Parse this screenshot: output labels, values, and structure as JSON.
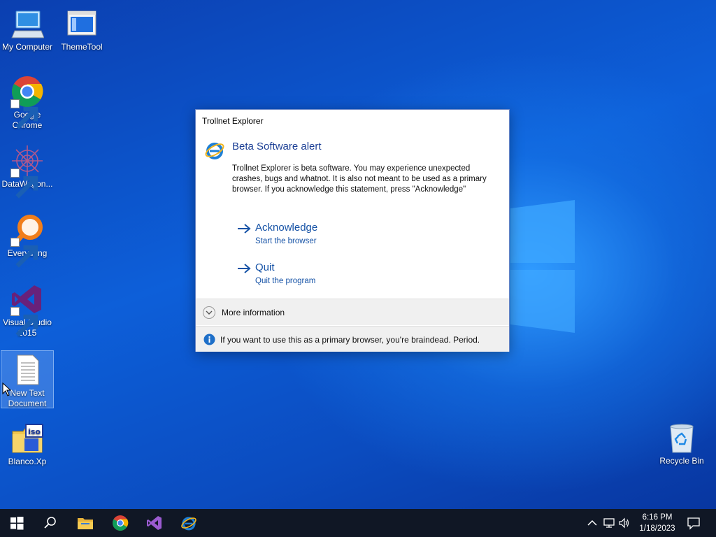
{
  "desktop": {
    "icons": [
      {
        "label": "My Computer"
      },
      {
        "label": "ThemeTool"
      },
      {
        "label": "Google Chrome"
      },
      {
        "label": "DataWagon..."
      },
      {
        "label": "Everything"
      },
      {
        "label": "Visual Studio 2015"
      },
      {
        "label": "New Text Document"
      },
      {
        "label": "Blanco.Xp"
      },
      {
        "label": "Recycle Bin"
      }
    ]
  },
  "dialog": {
    "title": "Trollnet Explorer",
    "heading": "Beta Software alert",
    "body": "Trollnet Explorer is beta software. You may experience unexpected crashes, bugs and whatnot. It is also not meant to be used as a primary browser. If you acknowledge this statement, press \"Acknowledge\"",
    "commands": [
      {
        "label": "Acknowledge",
        "sub": "Start the browser"
      },
      {
        "label": "Quit",
        "sub": "Quit the program"
      }
    ],
    "expander_label": "More information",
    "footer_text": "If you want to use this as a primary browser, you're braindead. Period."
  },
  "taskbar": {
    "time": "6:16 PM",
    "date": "1/18/2023"
  },
  "colors": {
    "accent": "#1552a6",
    "heading": "#1c3f95",
    "taskbar": "#101725"
  }
}
